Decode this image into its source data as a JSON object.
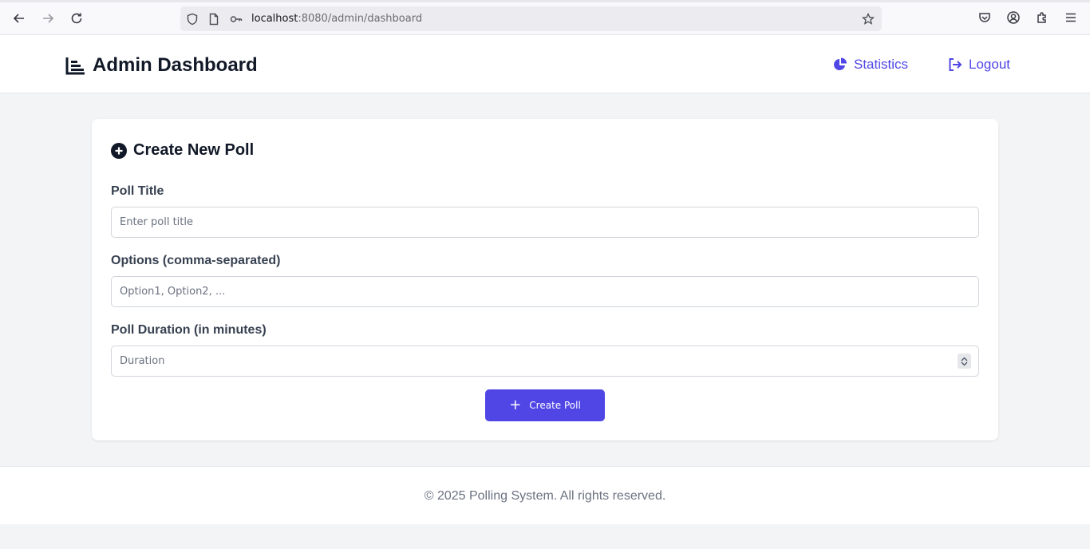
{
  "browser": {
    "url_host": "localhost",
    "url_rest": ":8080/admin/dashboard",
    "icons": [
      "back-arrow-icon",
      "forward-arrow-icon",
      "reload-icon",
      "shield-icon",
      "page-icon",
      "key-icon",
      "bookmark-star-icon",
      "pocket-icon",
      "account-icon",
      "extensions-icon",
      "menu-icon"
    ]
  },
  "header": {
    "title": "Admin Dashboard",
    "nav": {
      "statistics": "Statistics",
      "logout": "Logout"
    }
  },
  "form": {
    "heading": "Create New Poll",
    "title_label": "Poll Title",
    "title_placeholder": "Enter poll title",
    "options_label": "Options (comma-separated)",
    "options_placeholder": "Option1, Option2, ...",
    "duration_label": "Poll Duration (in minutes)",
    "duration_placeholder": "Duration",
    "submit_label": "Create Poll"
  },
  "footer": {
    "text": "© 2025 Polling System. All rights reserved."
  },
  "colors": {
    "accent": "#4f46e5",
    "text_dark": "#111827",
    "background": "#f3f4f6"
  }
}
